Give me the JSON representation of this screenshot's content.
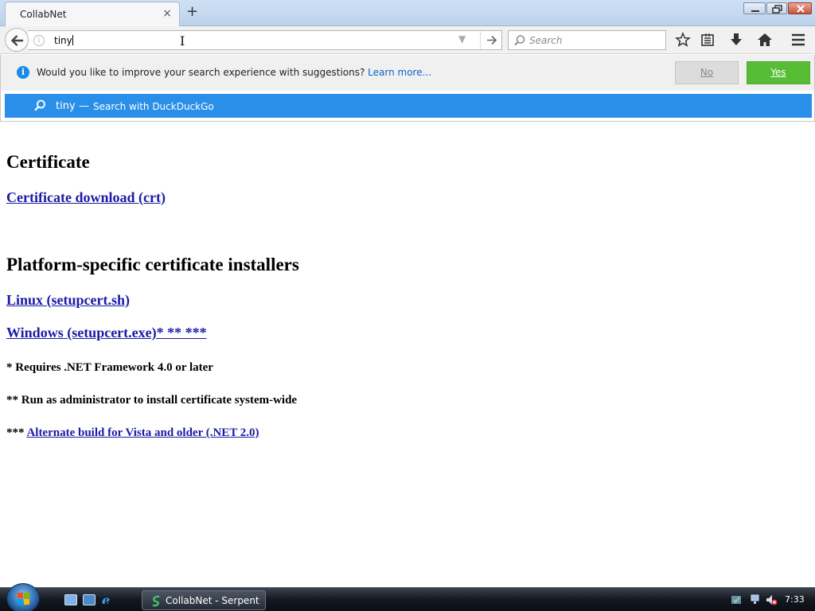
{
  "browser": {
    "tab_title": "CollabNet",
    "tab_close": "×",
    "new_tab": "+",
    "url_value": "tiny",
    "search_placeholder": "Search"
  },
  "notification": {
    "text": "Would you like to improve your search experience with suggestions?",
    "link": "Learn more...",
    "no_label": "No",
    "yes_label": "Yes"
  },
  "suggestion": {
    "term": "tiny",
    "dash": "—",
    "action": "Search with DuckDuckGo"
  },
  "page": {
    "heading_certificate": "Certificate",
    "link_crt": "Certificate download (crt)",
    "heading_installers": "Platform-specific certificate installers",
    "link_linux": "Linux (setupcert.sh)",
    "link_windows": "Windows (setupcert.exe)* ** ***",
    "note_1": "* Requires .NET Framework 4.0 or later",
    "note_2": "** Run as administrator to install certificate system-wide",
    "note_3_prefix": "***",
    "note_3_link": "Alternate build for Vista and older (.NET 2.0)"
  },
  "taskbar": {
    "task_label": "CollabNet - Serpent",
    "clock": "7:33"
  },
  "colors": {
    "suggestion_bg": "#2a8fe8",
    "yes_button": "#57bd35",
    "link": "#1a1aa6"
  }
}
